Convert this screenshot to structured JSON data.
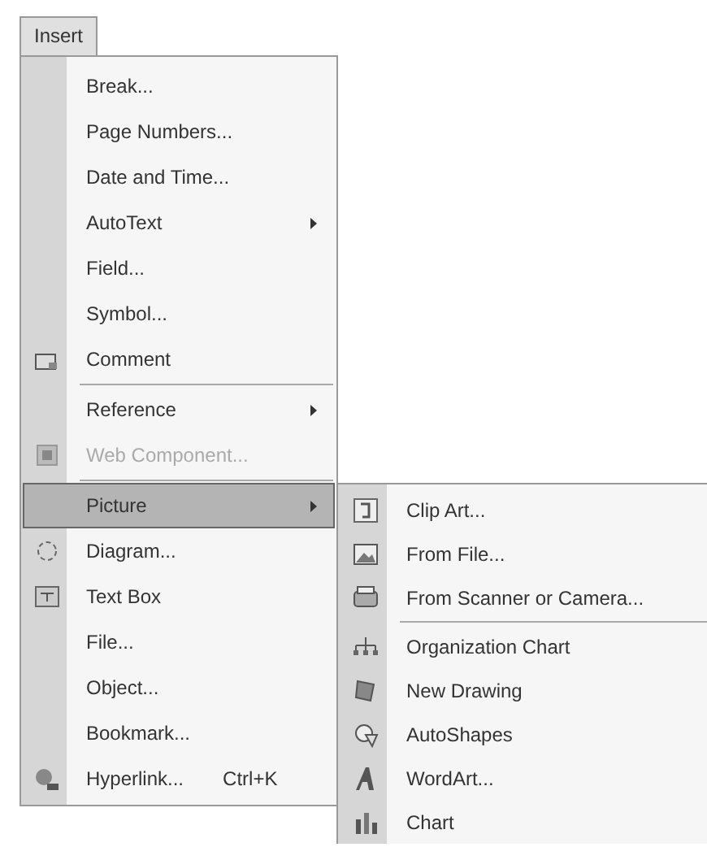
{
  "menu_bar": [
    {
      "label": "Insert",
      "selected": true
    }
  ],
  "menu": {
    "items": [
      {
        "kind": "item",
        "label": "Break...",
        "disabled": false,
        "submenu": false,
        "selected": false
      },
      {
        "kind": "item",
        "label": "Page Numbers...",
        "disabled": false,
        "submenu": false,
        "selected": false
      },
      {
        "kind": "item",
        "label": "Date and Time...",
        "disabled": false,
        "submenu": false,
        "selected": false
      },
      {
        "kind": "item",
        "label": "AutoText",
        "disabled": false,
        "submenu": true,
        "selected": false
      },
      {
        "kind": "item",
        "label": "Field...",
        "disabled": false,
        "submenu": false,
        "selected": false
      },
      {
        "kind": "item",
        "label": "Symbol...",
        "disabled": false,
        "submenu": false,
        "selected": false
      },
      {
        "kind": "item",
        "label": "Comment",
        "disabled": false,
        "submenu": false,
        "selected": false
      },
      {
        "kind": "separator"
      },
      {
        "kind": "item",
        "label": "Reference",
        "disabled": false,
        "submenu": true,
        "selected": false
      },
      {
        "kind": "item",
        "label": "Web Component...",
        "disabled": true,
        "submenu": false,
        "selected": false
      },
      {
        "kind": "separator"
      },
      {
        "kind": "item",
        "label": "Picture",
        "disabled": false,
        "submenu": true,
        "selected": true
      },
      {
        "kind": "item",
        "label": "Diagram...",
        "disabled": false,
        "submenu": false,
        "selected": false
      },
      {
        "kind": "item",
        "label": "Text Box",
        "disabled": false,
        "submenu": false,
        "selected": false
      },
      {
        "kind": "item",
        "label": "File...",
        "disabled": false,
        "submenu": false,
        "selected": false
      },
      {
        "kind": "item",
        "label": "Object...",
        "disabled": false,
        "submenu": false,
        "selected": false
      },
      {
        "kind": "item",
        "label": "Bookmark...",
        "disabled": false,
        "submenu": false,
        "selected": false
      },
      {
        "kind": "item",
        "label": "Hyperlink...",
        "shortcut": "Ctrl+K",
        "disabled": false,
        "submenu": false,
        "selected": false
      }
    ]
  },
  "submenu": {
    "items": [
      {
        "kind": "item",
        "label": "Clip Art..."
      },
      {
        "kind": "item",
        "label": "From File..."
      },
      {
        "kind": "item",
        "label": "From Scanner or Camera..."
      },
      {
        "kind": "separator"
      },
      {
        "kind": "item",
        "label": "Organization Chart"
      },
      {
        "kind": "item",
        "label": "New Drawing"
      },
      {
        "kind": "item",
        "label": "AutoShapes"
      },
      {
        "kind": "item",
        "label": "WordArt..."
      },
      {
        "kind": "item",
        "label": "Chart"
      }
    ]
  }
}
